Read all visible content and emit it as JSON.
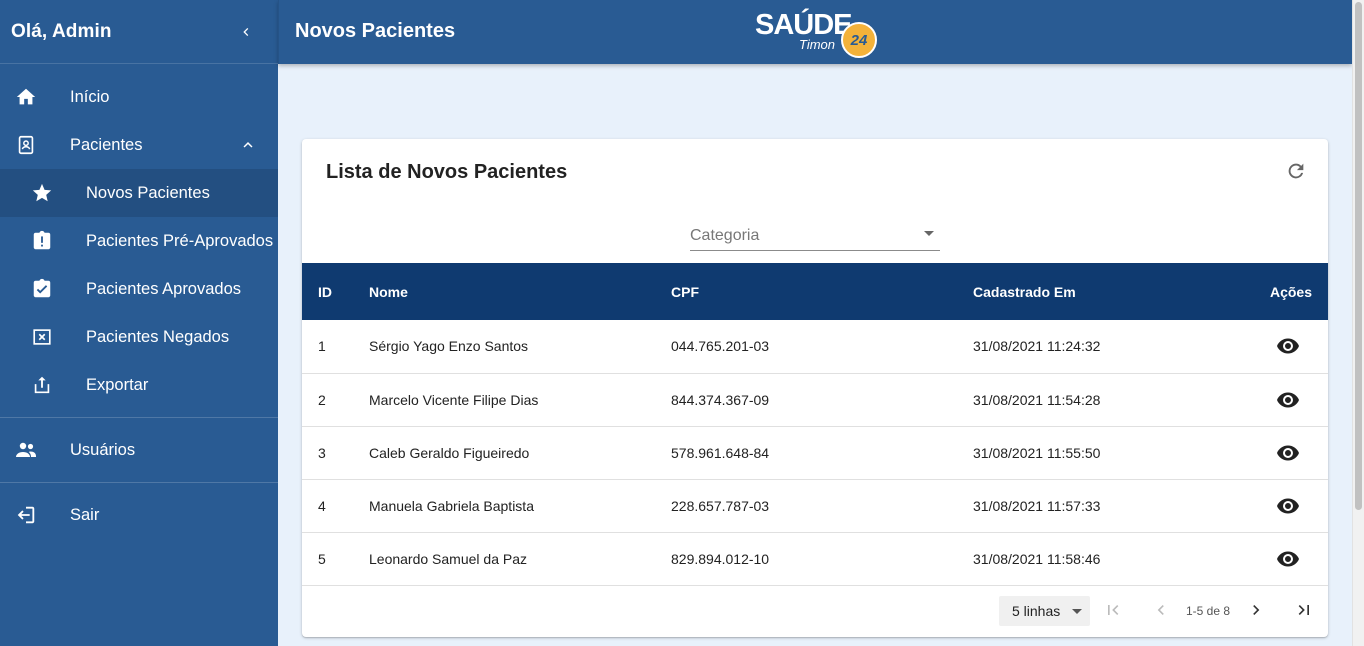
{
  "sidebar": {
    "greeting": "Olá, Admin",
    "items": [
      {
        "label": "Início",
        "icon": "home-icon"
      },
      {
        "label": "Pacientes",
        "icon": "badge-icon"
      },
      {
        "label": "Novos Pacientes",
        "icon": "star-icon"
      },
      {
        "label": "Pacientes Pré-Aprovados",
        "icon": "clipboard-alert-icon"
      },
      {
        "label": "Pacientes Aprovados",
        "icon": "clipboard-check-icon"
      },
      {
        "label": "Pacientes Negados",
        "icon": "close-box-icon"
      },
      {
        "label": "Exportar",
        "icon": "upload-icon"
      },
      {
        "label": "Usuários",
        "icon": "people-icon"
      },
      {
        "label": "Sair",
        "icon": "exit-icon"
      }
    ]
  },
  "header": {
    "title": "Novos Pacientes",
    "logo_text": "SAÚDE",
    "logo_sub": "Timon",
    "logo_badge": "24"
  },
  "card": {
    "title": "Lista de Novos Pacientes",
    "filter_placeholder": "Categoria"
  },
  "table": {
    "columns": [
      "ID",
      "Nome",
      "CPF",
      "Cadastrado Em",
      "Ações"
    ],
    "rows": [
      {
        "id": "1",
        "nome": "Sérgio Yago Enzo Santos",
        "cpf": "044.765.201-03",
        "data": "31/08/2021 11:24:32"
      },
      {
        "id": "2",
        "nome": "Marcelo Vicente Filipe Dias",
        "cpf": "844.374.367-09",
        "data": "31/08/2021 11:54:28"
      },
      {
        "id": "3",
        "nome": "Caleb Geraldo Figueiredo",
        "cpf": "578.961.648-84",
        "data": "31/08/2021 11:55:50"
      },
      {
        "id": "4",
        "nome": "Manuela Gabriela Baptista",
        "cpf": "228.657.787-03",
        "data": "31/08/2021 11:57:33"
      },
      {
        "id": "5",
        "nome": "Leonardo Samuel da Paz",
        "cpf": "829.894.012-10",
        "data": "31/08/2021 11:58:46"
      }
    ]
  },
  "pagination": {
    "rows_per_page": "5 linhas",
    "range": "1-5 de 8"
  },
  "colors": {
    "sidebar": "#295b93",
    "table_header": "#0f3a70",
    "background": "#e8f1fb",
    "logo_badge": "#f3b23a"
  }
}
